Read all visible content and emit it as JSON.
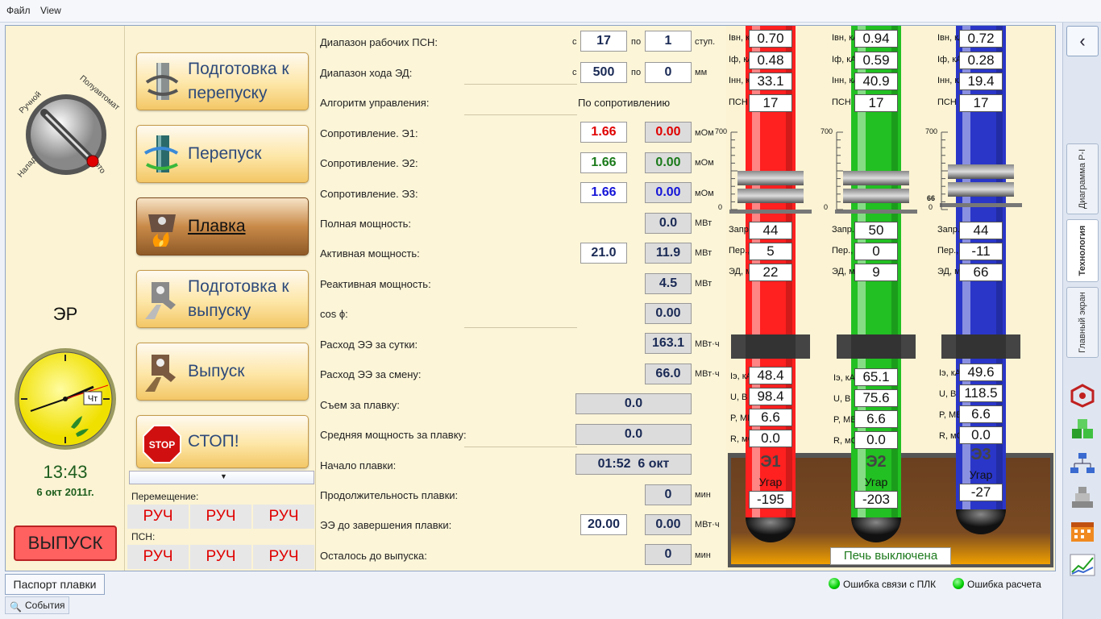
{
  "menu": {
    "file": "Файл",
    "view": "View"
  },
  "mode_switch": {
    "manual": "Ручной",
    "semi": "Полуавтомат",
    "setup": "Наладка",
    "auto": "Авто"
  },
  "er_label": "ЭР",
  "clock": {
    "time": "13:43",
    "date": "6 окт 2011г.",
    "weekday": "Чт"
  },
  "release_button": "ВЫПУСК",
  "operations": [
    {
      "label": "Подготовка к перепуску",
      "icon": "electrode-slip-prep-icon"
    },
    {
      "label": "Перепуск",
      "icon": "electrode-slip-icon"
    },
    {
      "label": "Плавка",
      "icon": "melting-icon",
      "active": true
    },
    {
      "label": "Подготовка к выпуску",
      "icon": "tapping-prep-icon"
    },
    {
      "label": "Выпуск",
      "icon": "tapping-icon"
    },
    {
      "label": "СТОП!",
      "icon": "stop-sign-icon",
      "sign": "STOP"
    }
  ],
  "movement": {
    "label": "Перемещение:",
    "values": [
      "РУЧ",
      "РУЧ",
      "РУЧ"
    ]
  },
  "psn": {
    "label": "ПСН:",
    "values": [
      "РУЧ",
      "РУЧ",
      "РУЧ"
    ]
  },
  "params": {
    "psn_range": {
      "label": "Диапазон рабочих ПСН:",
      "from_label": "с",
      "from": "17",
      "to_label": "по",
      "to": "1",
      "unit": "ступ."
    },
    "ed_range": {
      "label": "Диапазон хода ЭД:",
      "from_label": "с",
      "from": "500",
      "to_label": "по",
      "to": "0",
      "unit": "мм"
    },
    "algorithm": {
      "label": "Алгоритм управления:",
      "value": "По сопротивлению"
    },
    "r1": {
      "label": "Сопротивление. Э1:",
      "set": "1.66",
      "actual": "0.00",
      "unit": "мОм"
    },
    "r2": {
      "label": "Сопротивление. Э2:",
      "set": "1.66",
      "actual": "0.00",
      "unit": "мОм"
    },
    "r3": {
      "label": "Сопротивление. Э3:",
      "set": "1.66",
      "actual": "0.00",
      "unit": "мОм"
    },
    "full_power": {
      "label": "Полная мощность:",
      "value": "0.0",
      "unit": "МВт"
    },
    "active_power": {
      "label": "Активная мощность:",
      "set": "21.0",
      "value": "11.9",
      "unit": "МВт"
    },
    "reactive_power": {
      "label": "Реактивная мощность:",
      "value": "4.5",
      "unit": "МВт"
    },
    "cos_phi": {
      "label": "cos ϕ:",
      "value": "0.00"
    },
    "energy_day": {
      "label": "Расход ЭЭ за сутки:",
      "value": "163.1",
      "unit": "МВт·ч"
    },
    "energy_shift": {
      "label": "Расход ЭЭ за смену:",
      "value": "66.0",
      "unit": "МВт·ч"
    },
    "yield": {
      "label": "Съем за плавку:",
      "value": "0.0"
    },
    "avg_power": {
      "label": "Средняя мощность за плавку:",
      "value": "0.0"
    },
    "start": {
      "label": "Начало плавки:",
      "value": "01:52  6 окт"
    },
    "duration": {
      "label": "Продолжительность плавки:",
      "value": "0",
      "unit": "мин"
    },
    "energy_left": {
      "label": "ЭЭ до завершения плавки:",
      "set": "20.00",
      "value": "0.00",
      "unit": "МВт·ч"
    },
    "time_left": {
      "label": "Осталось до выпуска:",
      "value": "0",
      "unit": "мин"
    }
  },
  "electrode_labels": {
    "ivn": "Iвн, кА",
    "if": "Iф, кА",
    "inn": "Iнн, кА",
    "psn": "ПСН",
    "zapr": "Запр., мм",
    "per": "Пер., мм",
    "ed": "ЭД, мм",
    "ie": "Iэ, кА",
    "u": "U, В",
    "p": "P, МВт",
    "r": "R, мОм",
    "ugar": "Угар",
    "scale_top": "700",
    "scale_bottom": "0"
  },
  "electrodes": [
    {
      "name": "Э1",
      "color": "#ff2020",
      "ivn": "0.70",
      "if": "0.48",
      "inn": "33.1",
      "psn": "17",
      "zapr": "44",
      "per": "5",
      "ed": "22",
      "ie": "48.4",
      "u": "98.4",
      "p": "6.6",
      "r": "0.0",
      "ugar": "-195",
      "marker": ""
    },
    {
      "name": "Э2",
      "color": "#22c022",
      "ivn": "0.94",
      "if": "0.59",
      "inn": "40.9",
      "psn": "17",
      "zapr": "50",
      "per": "0",
      "ed": "9",
      "ie": "65.1",
      "u": "75.6",
      "p": "6.6",
      "r": "0.0",
      "ugar": "-203",
      "marker": ""
    },
    {
      "name": "Э3",
      "color": "#2a36c8",
      "ivn": "0.72",
      "if": "0.28",
      "inn": "19.4",
      "psn": "17",
      "zapr": "44",
      "per": "-11",
      "ed": "66",
      "ie": "49.6",
      "u": "118.5",
      "p": "6.6",
      "r": "0.0",
      "ugar": "-27",
      "marker": "66"
    }
  ],
  "furnace_status": "Печь выключена",
  "side_tabs": [
    "Диаграмма P-I",
    "Технология",
    "Главный экран"
  ],
  "bottom": {
    "passport": "Паспорт плавки",
    "events": "События",
    "plc_error": "Ошибка связи с ПЛК",
    "calc_error": "Ошибка расчета"
  },
  "colors": {
    "r1": "#e00000",
    "r2": "#1a7a1a",
    "r3": "#1414d8",
    "ruc": "#e00000"
  }
}
